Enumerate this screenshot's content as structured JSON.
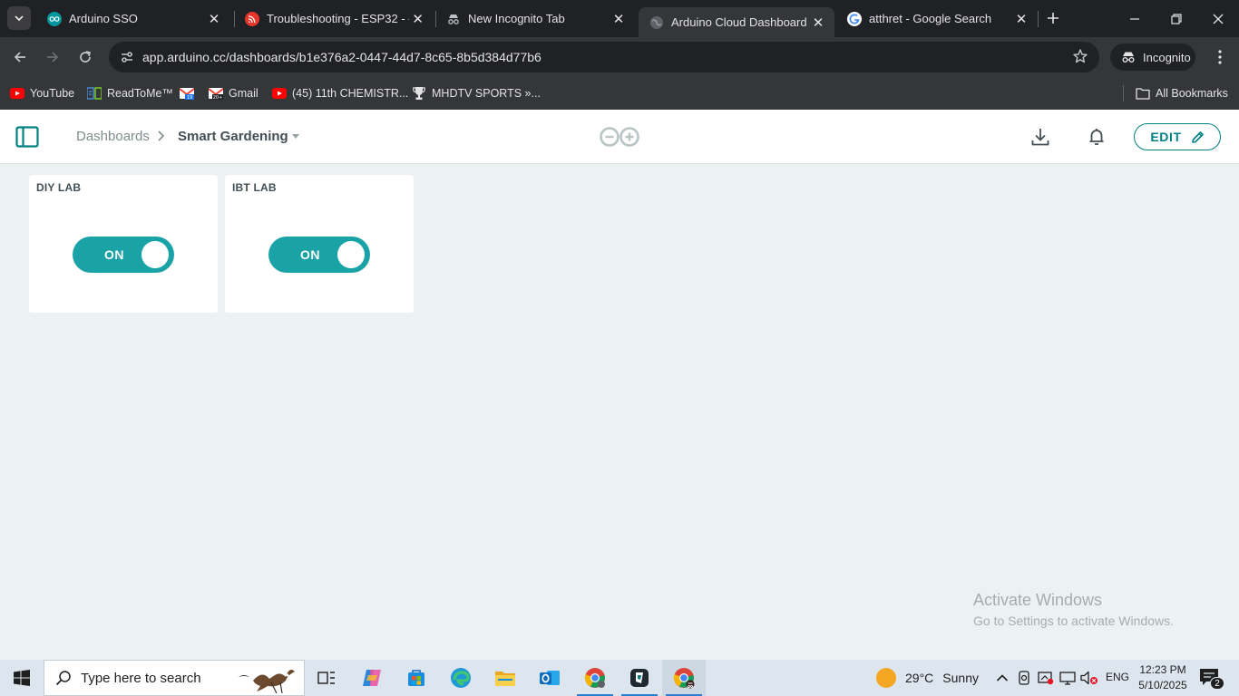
{
  "browser": {
    "tabs": [
      {
        "title": "Arduino SSO",
        "icon": "arduino-icon",
        "active": false
      },
      {
        "title": "Troubleshooting - ESP32 - —",
        "icon": "espressif-icon",
        "active": false
      },
      {
        "title": "New Incognito Tab",
        "icon": "incognito-icon",
        "active": false
      },
      {
        "title": "Arduino Cloud Dashboard",
        "icon": "globe-icon",
        "active": true
      },
      {
        "title": "atthret - Google Search",
        "icon": "google-icon",
        "active": false
      }
    ],
    "url": "app.arduino.cc/dashboards/b1e376a2-0447-44d7-8c65-8b5d384d77b6",
    "profile_label": "Incognito",
    "bookmarks": [
      {
        "label": "YouTube",
        "icon": "youtube-icon"
      },
      {
        "label": "ReadToMe™",
        "icon": "readtome-icon"
      },
      {
        "label": "",
        "icon": "gmail-icon"
      },
      {
        "label": "Gmail",
        "icon": "gmail-20-icon"
      },
      {
        "label": "(45) 11th CHEMISTR...",
        "icon": "youtube-icon"
      },
      {
        "label": "MHDTV SPORTS »...",
        "icon": "trophy-icon"
      }
    ],
    "all_bookmarks_label": "All Bookmarks"
  },
  "app": {
    "breadcrumb_root": "Dashboards",
    "dashboard_name": "Smart Gardening",
    "edit_label": "EDIT",
    "widgets": [
      {
        "title": "DIY LAB",
        "state_label": "ON",
        "state": true
      },
      {
        "title": "IBT LAB",
        "state_label": "ON",
        "state": true
      }
    ]
  },
  "watermark": {
    "line1": "Activate Windows",
    "line2": "Go to Settings to activate Windows."
  },
  "taskbar": {
    "search_placeholder": "Type here to search",
    "weather_temp": "29°C",
    "weather_condition": "Sunny",
    "language": "ENG",
    "time": "12:23 PM",
    "date": "5/10/2025",
    "notification_count": "2"
  },
  "colors": {
    "accent": "#008184",
    "switch_on": "#1aa3a6",
    "page_bg": "#ecf1f1",
    "chrome_dark": "#202124"
  }
}
